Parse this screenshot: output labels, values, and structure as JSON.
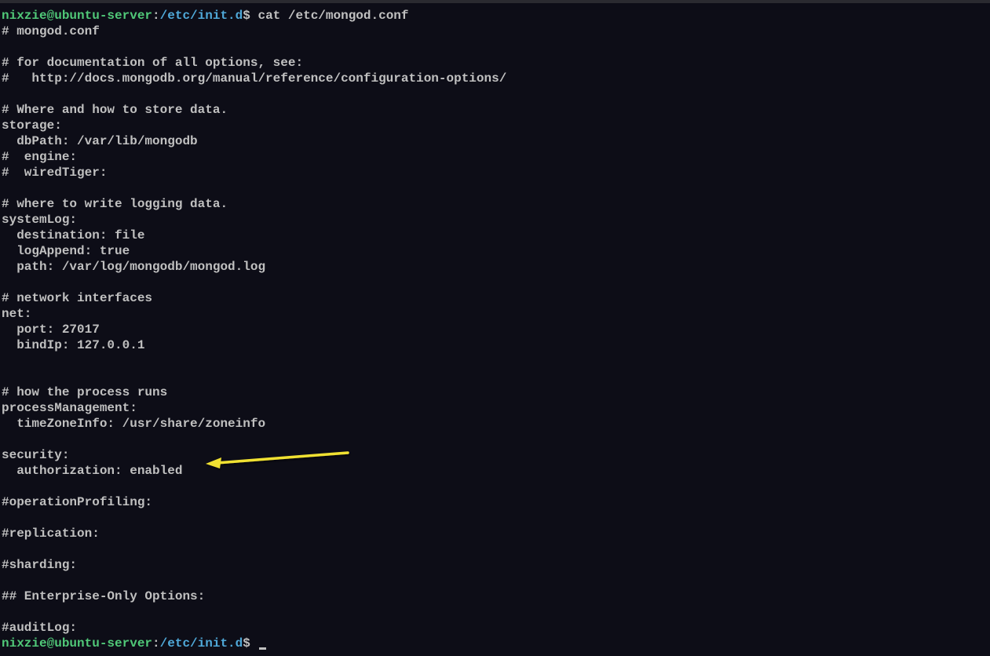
{
  "prompt1": {
    "user": "nixzie@ubuntu-server",
    "colon": ":",
    "path": "/etc/init.d",
    "dollar": "$",
    "command": " cat /etc/mongod.conf"
  },
  "output_lines": [
    "# mongod.conf",
    "",
    "# for documentation of all options, see:",
    "#   http://docs.mongodb.org/manual/reference/configuration-options/",
    "",
    "# Where and how to store data.",
    "storage:",
    "  dbPath: /var/lib/mongodb",
    "#  engine:",
    "#  wiredTiger:",
    "",
    "# where to write logging data.",
    "systemLog:",
    "  destination: file",
    "  logAppend: true",
    "  path: /var/log/mongodb/mongod.log",
    "",
    "# network interfaces",
    "net:",
    "  port: 27017",
    "  bindIp: 127.0.0.1",
    "",
    "",
    "# how the process runs",
    "processManagement:",
    "  timeZoneInfo: /usr/share/zoneinfo",
    "",
    "security:",
    "  authorization: enabled",
    "",
    "#operationProfiling:",
    "",
    "#replication:",
    "",
    "#sharding:",
    "",
    "## Enterprise-Only Options:",
    "",
    "#auditLog:"
  ],
  "prompt2": {
    "user": "nixzie@ubuntu-server",
    "colon": ":",
    "path": "/etc/init.d",
    "dollar": "$"
  },
  "annotation": {
    "arrow_color": "#f0e130",
    "target_line": "authorization: enabled"
  }
}
